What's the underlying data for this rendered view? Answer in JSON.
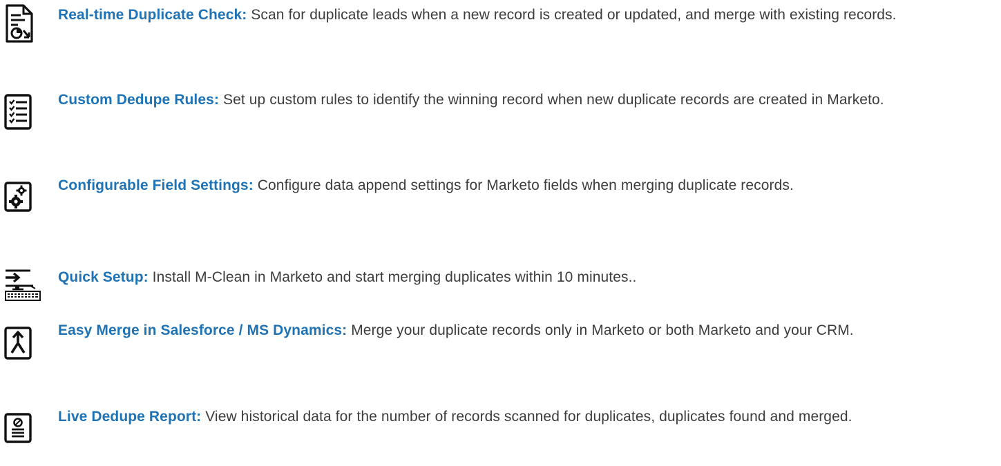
{
  "features": [
    {
      "icon": "document-sync-icon",
      "title": "Real-time Duplicate Check:",
      "description": "Scan for duplicate leads when a new record is created or updated, and merge with existing records."
    },
    {
      "icon": "checklist-icon",
      "title": "Custom Dedupe Rules:",
      "description": "Set up custom rules to identify the winning record when new duplicate records are created in Marketo."
    },
    {
      "icon": "gears-document-icon",
      "title": "Configurable Field Settings:",
      "description": "Configure data append settings for Marketo fields when merging duplicate records."
    },
    {
      "icon": "computer-setup-icon",
      "title": "Quick Setup:",
      "description": "Install M-Clean in Marketo and start merging duplicates within 10 minutes.."
    },
    {
      "icon": "merge-arrow-icon",
      "title": "Easy Merge in Salesforce / MS Dynamics:",
      "description": "Merge your duplicate records only in Marketo or both Marketo and your CRM."
    },
    {
      "icon": "report-document-icon",
      "title": "Live Dedupe Report:",
      "description": "View historical data for the number of records scanned for duplicates, duplicates found and merged."
    }
  ],
  "colors": {
    "title": "#1f73b5",
    "body_text": "#3c3c3c",
    "icon_stroke": "#111111"
  }
}
